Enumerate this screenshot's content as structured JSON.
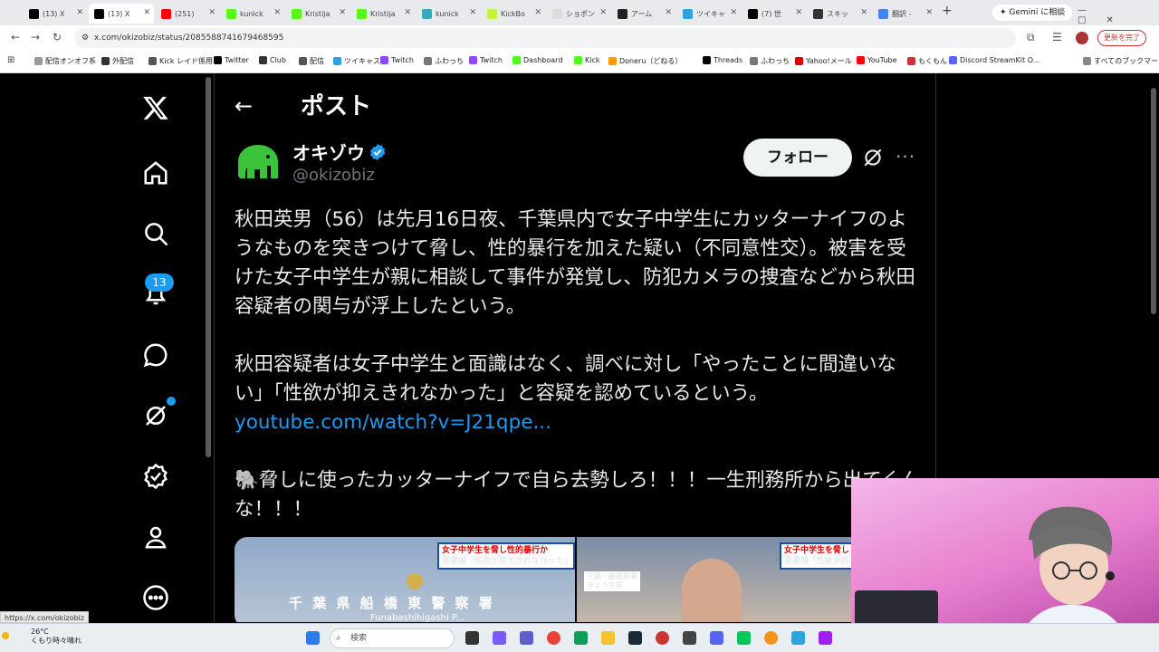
{
  "browser": {
    "tabs": [
      {
        "label": "(13) X",
        "color": "#000000"
      },
      {
        "label": "(13) X",
        "color": "#000000"
      },
      {
        "label": "(251) ",
        "color": "#ff0000"
      },
      {
        "label": "kunick",
        "color": "#53fc18"
      },
      {
        "label": "Kristija",
        "color": "#53fc18"
      },
      {
        "label": "Kristija",
        "color": "#53fc18"
      },
      {
        "label": "kunick",
        "color": "#3aa8c1"
      },
      {
        "label": "KickBo",
        "color": "#c6f246"
      },
      {
        "label": "ショポン",
        "color": "#dddddd"
      },
      {
        "label": "アーム",
        "color": "#222222"
      },
      {
        "label": "ツイキャ",
        "color": "#2aa4e0"
      },
      {
        "label": "(7) 世",
        "color": "#000000"
      },
      {
        "label": "スキッ",
        "color": "#333333"
      },
      {
        "label": "翻訳 -",
        "color": "#4285f4"
      }
    ],
    "gemini_label": "Gemini に相談",
    "url": "x.com/okizobiz/status/2085588741679468595",
    "update_label": "更新を完了",
    "bookmarks": [
      "配信オンオフ系",
      "外配信",
      "Kick レイド係用",
      "Twitter",
      "Club",
      "配信",
      "ツイキャス",
      "Twitch",
      "ふわっち",
      "Twitch",
      "Dashboard",
      "Kick",
      "Doneru（どねる）",
      "...",
      "Threads",
      "ふわっち",
      "Yahoo!メール",
      "YouTube",
      "もくもん",
      "Discord StreamKit O...",
      "すべてのブックマーク"
    ],
    "status_url": "https://x.com/okizobiz"
  },
  "nav": {
    "notifications_count": "13"
  },
  "post": {
    "page_title": "ポスト",
    "author_name": "オキゾウ",
    "author_handle": "@okizobiz",
    "follow_label": "フォロー",
    "paragraph1": "秋田英男（56）は先月16日夜、千葉県内で女子中学生にカッターナイフのようなものを突きつけて脅し、性的暴行を加えた疑い（不同意性交）。被害を受けた女子中学生が親に相談して事件が発覚し、防犯カメラの捜査などから秋田容疑者の関与が浮上したという。",
    "paragraph2": "秋田容疑者は女子中学生と面識はなく、調べに対し「やったことに間違いない」「性欲が抑えきれなかった」と容疑を認めているという。",
    "link": "youtube.com/watch?v=J21qpe...",
    "paragraph3": "🐘脅しに使ったカッターナイフで自ら去勢しろ！！！一生刑務所から出てくんな！！！",
    "media": {
      "caption1_line1": "女子中学生を脅し性的暴行か",
      "caption1_line2": "男逮捕「性欲が抑えきれなかった」",
      "caption2_line1": "女子中学生を脅し",
      "caption2_line2": "男逮捕「性欲が抑えき",
      "location": "千葉・船橋東署",
      "time": "きょう午前",
      "sign": "千 葉 県 船 橋 東 警 察 署",
      "sign_roman": "Funabashihigashi P..."
    }
  },
  "taskbar": {
    "temperature": "26°C",
    "weather": "くもり時々晴れ",
    "search_placeholder": "検索"
  }
}
